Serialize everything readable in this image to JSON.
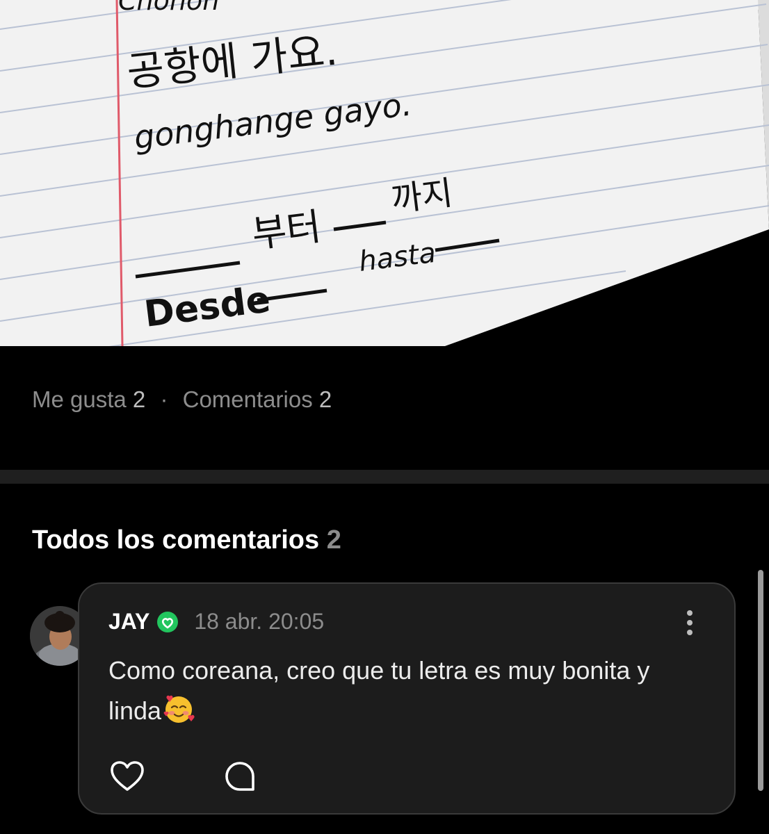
{
  "post": {
    "image": {
      "lines": [
        {
          "text": "Chohon"
        },
        {
          "text": "공항에 가요."
        },
        {
          "text": "gonghange gayo."
        },
        {
          "text": "부터"
        },
        {
          "text": "까지"
        },
        {
          "text": "Desde"
        },
        {
          "text": "hasta"
        }
      ]
    },
    "stats": {
      "likes_label": "Me gusta",
      "likes_count": "2",
      "separator": "·",
      "comments_label": "Comentarios",
      "comments_count": "2"
    }
  },
  "comments_section": {
    "title": "Todos los comentarios",
    "count": "2",
    "comments": [
      {
        "author": "JAY",
        "verified_icon": "verified-badge-icon",
        "timestamp": "18 abr. 20:05",
        "text": "Como coreana, creo que tu letra es muy bonita y linda",
        "emoji_icon": "smiling-face-with-hearts-icon",
        "actions": {
          "more_icon": "more-vertical-icon",
          "like_icon": "heart-outline-icon",
          "reply_icon": "speech-bubble-icon"
        }
      }
    ]
  },
  "colors": {
    "background": "#000000",
    "card_background": "#1c1c1c",
    "card_border": "#3a3a3a",
    "muted_text": "#8c8c8c",
    "verified_green": "#22c55e",
    "notebook_margin": "#e05a6a",
    "notebook_rule": "#b9c2d4"
  }
}
